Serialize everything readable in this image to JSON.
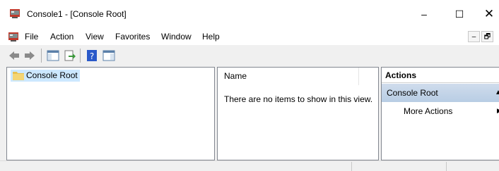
{
  "window": {
    "title": "Console1 - [Console Root]",
    "icon": "mmc-console-icon",
    "controls": {
      "minimize": "–",
      "maximize": "☐",
      "close": "✕"
    }
  },
  "menubar": {
    "icon": "mmc-console-icon",
    "items": [
      "File",
      "Action",
      "View",
      "Favorites",
      "Window",
      "Help"
    ],
    "mdi_controls": {
      "minimize": "–",
      "restore": "🗗"
    }
  },
  "toolbar": {
    "buttons": [
      "back-icon",
      "forward-icon",
      "show-hide-tree-icon",
      "export-list-icon",
      "help-icon",
      "show-hide-action-pane-icon"
    ]
  },
  "tree": {
    "items": [
      {
        "label": "Console Root",
        "icon": "folder-icon",
        "selected": true
      }
    ]
  },
  "list": {
    "column_header": "Name",
    "empty_message": "There are no items to show in this view."
  },
  "actions": {
    "header": "Actions",
    "section_title": "Console Root",
    "items": [
      {
        "label": "More Actions"
      }
    ]
  }
}
